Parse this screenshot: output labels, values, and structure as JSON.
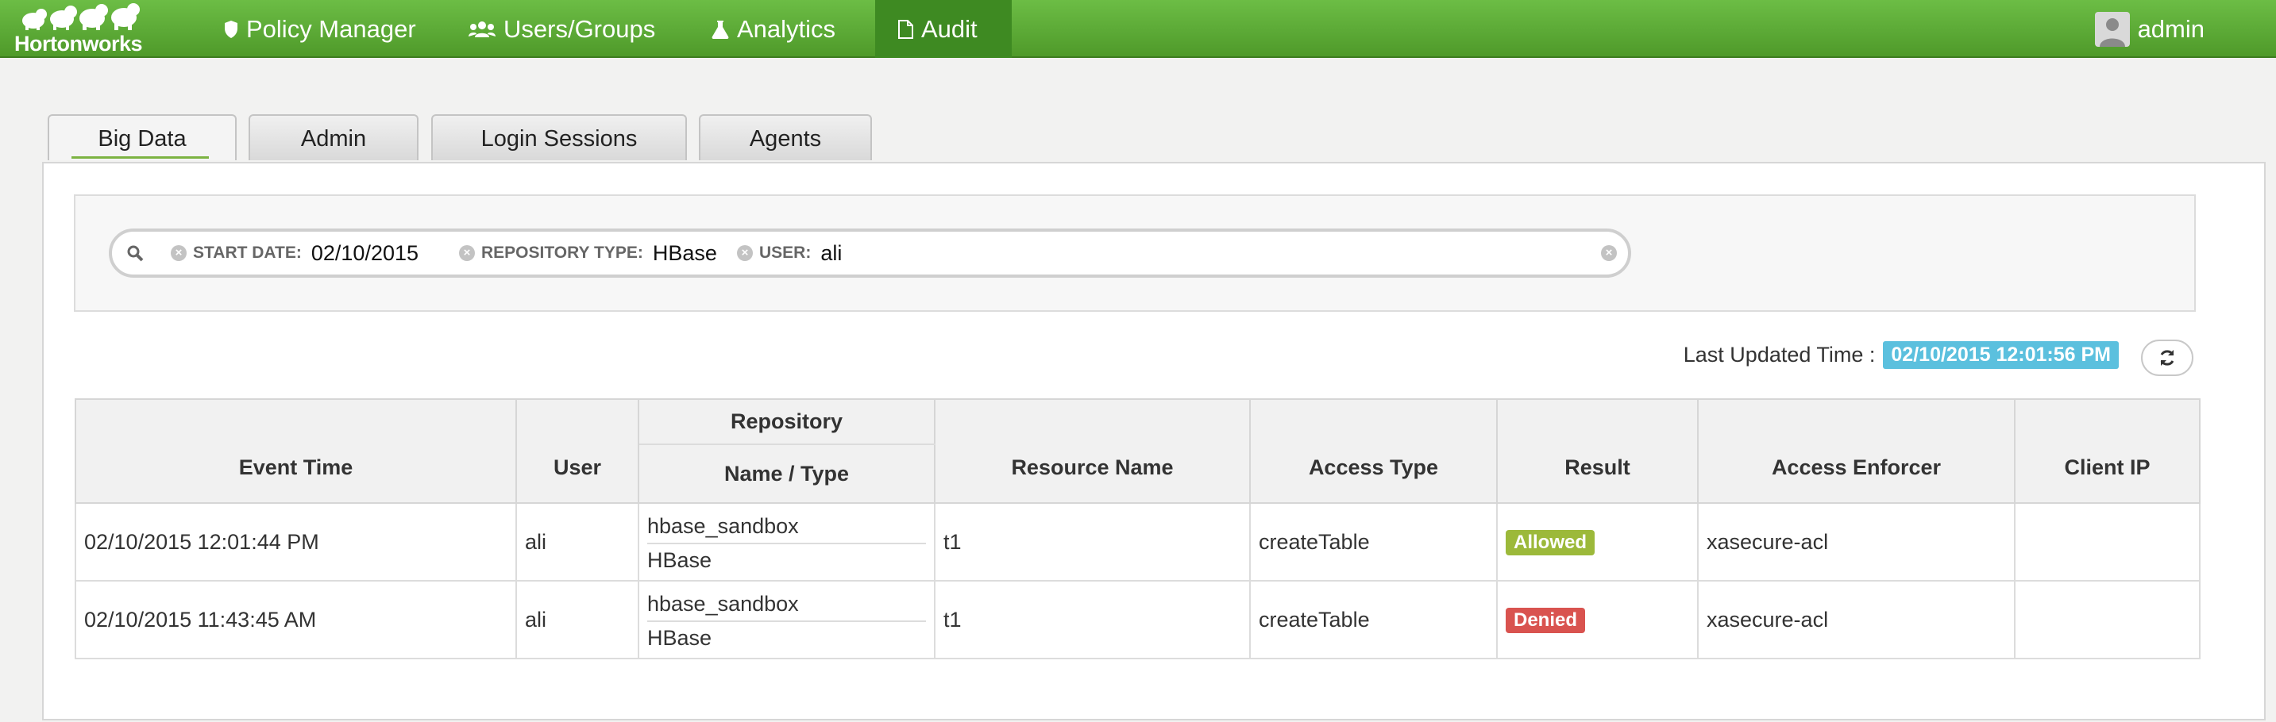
{
  "navbar": {
    "brand": "Hortonworks",
    "items": [
      {
        "label": "Policy Manager",
        "icon": "shield-icon"
      },
      {
        "label": "Users/Groups",
        "icon": "users-icon"
      },
      {
        "label": "Analytics",
        "icon": "flask-icon"
      },
      {
        "label": "Audit",
        "icon": "document-icon",
        "active": true
      }
    ],
    "user": "admin"
  },
  "tabs": [
    {
      "label": "Big Data",
      "active": true
    },
    {
      "label": "Admin"
    },
    {
      "label": "Login Sessions"
    },
    {
      "label": "Agents"
    }
  ],
  "search": {
    "facets": [
      {
        "category": "START DATE:",
        "value": "02/10/2015"
      },
      {
        "category": "REPOSITORY TYPE:",
        "value": "HBase"
      },
      {
        "category": "USER:",
        "value": "ali"
      }
    ]
  },
  "last_updated": {
    "label": "Last Updated Time :",
    "value": "02/10/2015 12:01:56 PM"
  },
  "table": {
    "headers": {
      "event_time": "Event Time",
      "user": "User",
      "repository": "Repository",
      "repository_sub": "Name / Type",
      "resource_name": "Resource Name",
      "access_type": "Access Type",
      "result": "Result",
      "access_enforcer": "Access Enforcer",
      "client_ip": "Client IP"
    },
    "rows": [
      {
        "event_time": "02/10/2015 12:01:44 PM",
        "user": "ali",
        "repo_name": "hbase_sandbox",
        "repo_type": "HBase",
        "resource_name": "t1",
        "access_type": "createTable",
        "result": "Allowed",
        "access_enforcer": "xasecure-acl",
        "client_ip": ""
      },
      {
        "event_time": "02/10/2015 11:43:45 AM",
        "user": "ali",
        "repo_name": "hbase_sandbox",
        "repo_type": "HBase",
        "resource_name": "t1",
        "access_type": "createTable",
        "result": "Denied",
        "access_enforcer": "xasecure-acl",
        "client_ip": ""
      }
    ]
  },
  "colors": {
    "navbar": "#5aab33",
    "nav_active": "#3e8a22",
    "allowed": "#9cb93a",
    "denied": "#d9534f",
    "timestamp_badge": "#5bc0de"
  }
}
